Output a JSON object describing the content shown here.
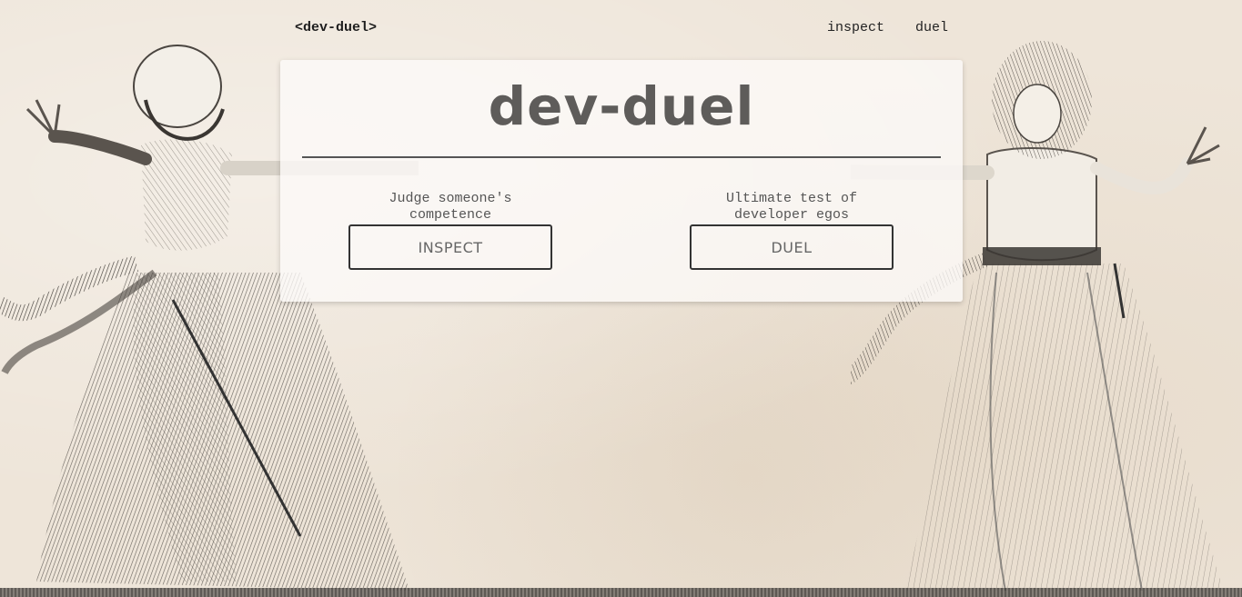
{
  "nav": {
    "brand": "<dev-duel>",
    "links": [
      {
        "label": "inspect"
      },
      {
        "label": "duel"
      }
    ]
  },
  "hero": {
    "title": "dev-duel"
  },
  "options": [
    {
      "description": "Judge someone's competence",
      "button_label": "INSPECT"
    },
    {
      "description": "Ultimate test of developer egos",
      "button_label": "DUEL"
    }
  ],
  "colors": {
    "background": "#eee5d9",
    "card": "#fcfaf8",
    "title": "#5e5c5a",
    "ink": "#333333"
  },
  "background_image": "engraving of two women dueling with pistols"
}
